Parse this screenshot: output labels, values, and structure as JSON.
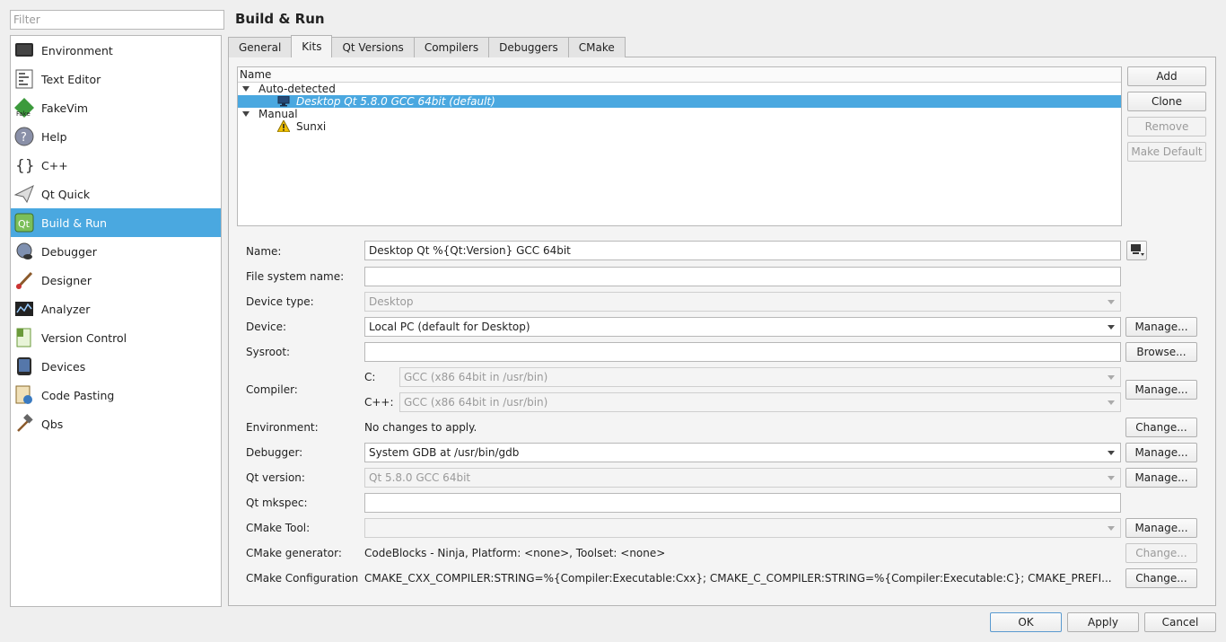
{
  "filter": {
    "placeholder": "Filter"
  },
  "sidebar": {
    "items": [
      {
        "label": "Environment",
        "icon": "monitor-icon"
      },
      {
        "label": "Text Editor",
        "icon": "text-editor-icon"
      },
      {
        "label": "FakeVim",
        "icon": "fakevim-icon"
      },
      {
        "label": "Help",
        "icon": "help-icon"
      },
      {
        "label": "C++",
        "icon": "braces-icon"
      },
      {
        "label": "Qt Quick",
        "icon": "paper-plane-icon"
      },
      {
        "label": "Build & Run",
        "icon": "qt-build-icon"
      },
      {
        "label": "Debugger",
        "icon": "bug-icon"
      },
      {
        "label": "Designer",
        "icon": "brush-icon"
      },
      {
        "label": "Analyzer",
        "icon": "analyzer-icon"
      },
      {
        "label": "Version Control",
        "icon": "version-control-icon"
      },
      {
        "label": "Devices",
        "icon": "tablet-icon"
      },
      {
        "label": "Code Pasting",
        "icon": "code-paste-icon"
      },
      {
        "label": "Qbs",
        "icon": "hammer-icon"
      }
    ],
    "selected": "Build & Run"
  },
  "page_title": "Build & Run",
  "tabs": [
    "General",
    "Kits",
    "Qt Versions",
    "Compilers",
    "Debuggers",
    "CMake"
  ],
  "active_tab": "Kits",
  "kits": {
    "column": "Name",
    "groups": [
      {
        "label": "Auto-detected",
        "kits": [
          {
            "name": "Desktop Qt 5.8.0 GCC 64bit (default)",
            "icon": "monitor-icon",
            "selected": true
          }
        ]
      },
      {
        "label": "Manual",
        "kits": [
          {
            "name": "Sunxi",
            "icon": "warning-icon",
            "selected": false
          }
        ]
      }
    ]
  },
  "kit_buttons": {
    "add": "Add",
    "clone": "Clone",
    "remove": "Remove",
    "make_default": "Make Default"
  },
  "form": {
    "name_label": "Name:",
    "name_value": "Desktop Qt %{Qt:Version} GCC 64bit",
    "fs_name_label": "File system name:",
    "fs_name_value": "",
    "device_type_label": "Device type:",
    "device_type_value": "Desktop",
    "device_label": "Device:",
    "device_value": "Local PC (default for Desktop)",
    "sysroot_label": "Sysroot:",
    "sysroot_value": "",
    "compiler_label": "Compiler:",
    "c_label": "C:",
    "c_value": "GCC (x86 64bit in /usr/bin)",
    "cxx_label": "C++:",
    "cxx_value": "GCC (x86 64bit in /usr/bin)",
    "environment_label": "Environment:",
    "environment_value": "No changes to apply.",
    "debugger_label": "Debugger:",
    "debugger_value": "System GDB at /usr/bin/gdb",
    "qt_version_label": "Qt version:",
    "qt_version_value": "Qt 5.8.0 GCC 64bit",
    "qt_mkspec_label": "Qt mkspec:",
    "qt_mkspec_value": "",
    "cmake_tool_label": "CMake Tool:",
    "cmake_tool_value": "",
    "cmake_generator_label": "CMake generator:",
    "cmake_generator_value": "CodeBlocks - Ninja, Platform: <none>, Toolset: <none>",
    "cmake_config_label": "CMake Configuration",
    "cmake_config_value": "CMAKE_CXX_COMPILER:STRING=%{Compiler:Executable:Cxx}; CMAKE_C_COMPILER:STRING=%{Compiler:Executable:C}; CMAKE_PREFI..."
  },
  "side_buttons": {
    "manage": "Manage...",
    "browse": "Browse...",
    "change": "Change..."
  },
  "dialog_buttons": {
    "ok": "OK",
    "apply": "Apply",
    "cancel": "Cancel"
  },
  "colors": {
    "selection": "#4aa8e0",
    "warning": "#f0c000"
  }
}
